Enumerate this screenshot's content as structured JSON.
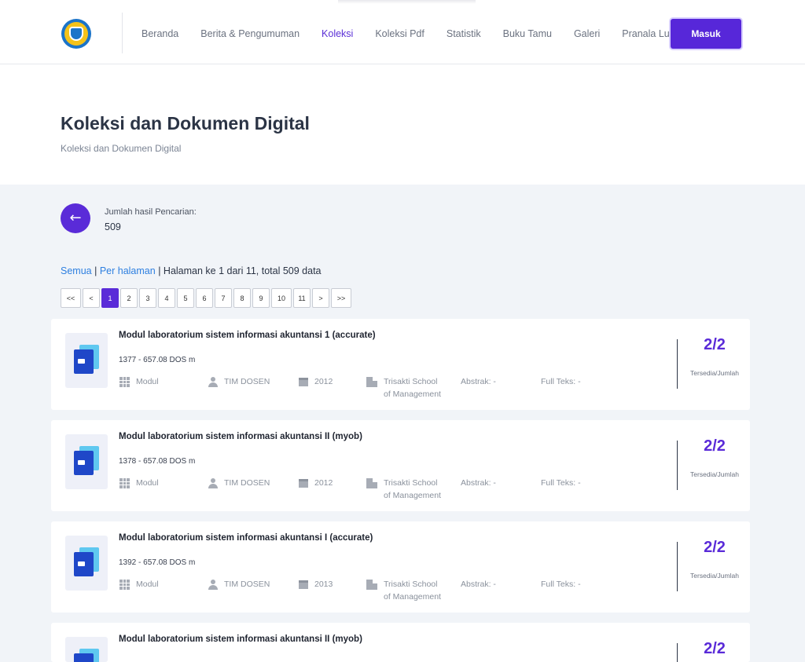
{
  "nav": {
    "links": [
      "Beranda",
      "Berita & Pengumuman",
      "Koleksi",
      "Koleksi Pdf",
      "Statistik",
      "Buku Tamu",
      "Galeri"
    ],
    "dropdown_label": "Pranala Luar",
    "login_label": "Masuk",
    "active": "Koleksi"
  },
  "header": {
    "title": "Koleksi dan Dokumen Digital",
    "breadcrumb": "Koleksi dan Dokumen Digital"
  },
  "search": {
    "count_label": "Jumlah hasil Pencarian:",
    "count_value": "509",
    "back_icon": "←"
  },
  "paging": {
    "all_label": "Semua",
    "per_page_label": "Per halaman",
    "sep": "|",
    "info": "Halaman ke 1 dari 11, total 509 data",
    "buttons": [
      "<<",
      "<",
      "1",
      "2",
      "3",
      "4",
      "5",
      "6",
      "7",
      "8",
      "9",
      "10",
      "11",
      ">",
      ">>"
    ],
    "current": "1"
  },
  "colors": {
    "accent": "#5a2bd8",
    "link": "#2d7fe0",
    "background": "#f1f4f8"
  },
  "results": [
    {
      "title": "Modul laboratorium sistem informasi akuntansi 1 (accurate)",
      "code": "1377 - 657.08 DOS m",
      "type": "Modul",
      "author": "TIM DOSEN",
      "year": "2012",
      "publisher_line1": "Trisakti School",
      "publisher_line2": "of Management",
      "abstract": "Abstrak: -",
      "fulltext": "Full Teks: -",
      "availability": "2/2",
      "availability_label": "Tersedia/Jumlah"
    },
    {
      "title": "Modul laboratorium sistem informasi akuntansi II (myob)",
      "code": "1378 - 657.08 DOS m",
      "type": "Modul",
      "author": "TIM DOSEN",
      "year": "2012",
      "publisher_line1": "Trisakti School",
      "publisher_line2": "of Management",
      "abstract": "Abstrak: -",
      "fulltext": "Full Teks: -",
      "availability": "2/2",
      "availability_label": "Tersedia/Jumlah"
    },
    {
      "title": "Modul laboratorium sistem informasi akuntansi I (accurate)",
      "code": "1392 - 657.08 DOS m",
      "type": "Modul",
      "author": "TIM DOSEN",
      "year": "2013",
      "publisher_line1": "Trisakti School",
      "publisher_line2": "of Management",
      "abstract": "Abstrak: -",
      "fulltext": "Full Teks: -",
      "availability": "2/2",
      "availability_label": "Tersedia/Jumlah"
    },
    {
      "title": "Modul laboratorium sistem informasi akuntansi II (myob)",
      "availability": "2/2"
    }
  ]
}
